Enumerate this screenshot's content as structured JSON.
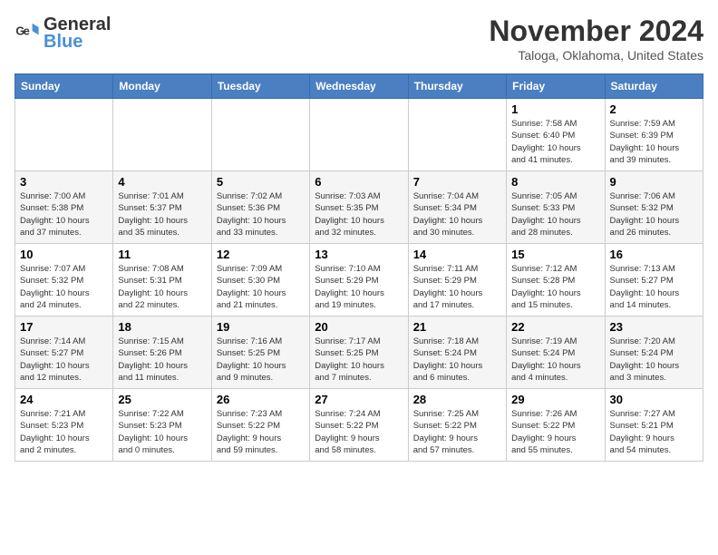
{
  "logo": {
    "line1": "General",
    "line2": "Blue"
  },
  "title": "November 2024",
  "location": "Taloga, Oklahoma, United States",
  "weekdays": [
    "Sunday",
    "Monday",
    "Tuesday",
    "Wednesday",
    "Thursday",
    "Friday",
    "Saturday"
  ],
  "weeks": [
    [
      {
        "day": "",
        "info": ""
      },
      {
        "day": "",
        "info": ""
      },
      {
        "day": "",
        "info": ""
      },
      {
        "day": "",
        "info": ""
      },
      {
        "day": "",
        "info": ""
      },
      {
        "day": "1",
        "info": "Sunrise: 7:58 AM\nSunset: 6:40 PM\nDaylight: 10 hours\nand 41 minutes."
      },
      {
        "day": "2",
        "info": "Sunrise: 7:59 AM\nSunset: 6:39 PM\nDaylight: 10 hours\nand 39 minutes."
      }
    ],
    [
      {
        "day": "3",
        "info": "Sunrise: 7:00 AM\nSunset: 5:38 PM\nDaylight: 10 hours\nand 37 minutes."
      },
      {
        "day": "4",
        "info": "Sunrise: 7:01 AM\nSunset: 5:37 PM\nDaylight: 10 hours\nand 35 minutes."
      },
      {
        "day": "5",
        "info": "Sunrise: 7:02 AM\nSunset: 5:36 PM\nDaylight: 10 hours\nand 33 minutes."
      },
      {
        "day": "6",
        "info": "Sunrise: 7:03 AM\nSunset: 5:35 PM\nDaylight: 10 hours\nand 32 minutes."
      },
      {
        "day": "7",
        "info": "Sunrise: 7:04 AM\nSunset: 5:34 PM\nDaylight: 10 hours\nand 30 minutes."
      },
      {
        "day": "8",
        "info": "Sunrise: 7:05 AM\nSunset: 5:33 PM\nDaylight: 10 hours\nand 28 minutes."
      },
      {
        "day": "9",
        "info": "Sunrise: 7:06 AM\nSunset: 5:32 PM\nDaylight: 10 hours\nand 26 minutes."
      }
    ],
    [
      {
        "day": "10",
        "info": "Sunrise: 7:07 AM\nSunset: 5:32 PM\nDaylight: 10 hours\nand 24 minutes."
      },
      {
        "day": "11",
        "info": "Sunrise: 7:08 AM\nSunset: 5:31 PM\nDaylight: 10 hours\nand 22 minutes."
      },
      {
        "day": "12",
        "info": "Sunrise: 7:09 AM\nSunset: 5:30 PM\nDaylight: 10 hours\nand 21 minutes."
      },
      {
        "day": "13",
        "info": "Sunrise: 7:10 AM\nSunset: 5:29 PM\nDaylight: 10 hours\nand 19 minutes."
      },
      {
        "day": "14",
        "info": "Sunrise: 7:11 AM\nSunset: 5:29 PM\nDaylight: 10 hours\nand 17 minutes."
      },
      {
        "day": "15",
        "info": "Sunrise: 7:12 AM\nSunset: 5:28 PM\nDaylight: 10 hours\nand 15 minutes."
      },
      {
        "day": "16",
        "info": "Sunrise: 7:13 AM\nSunset: 5:27 PM\nDaylight: 10 hours\nand 14 minutes."
      }
    ],
    [
      {
        "day": "17",
        "info": "Sunrise: 7:14 AM\nSunset: 5:27 PM\nDaylight: 10 hours\nand 12 minutes."
      },
      {
        "day": "18",
        "info": "Sunrise: 7:15 AM\nSunset: 5:26 PM\nDaylight: 10 hours\nand 11 minutes."
      },
      {
        "day": "19",
        "info": "Sunrise: 7:16 AM\nSunset: 5:25 PM\nDaylight: 10 hours\nand 9 minutes."
      },
      {
        "day": "20",
        "info": "Sunrise: 7:17 AM\nSunset: 5:25 PM\nDaylight: 10 hours\nand 7 minutes."
      },
      {
        "day": "21",
        "info": "Sunrise: 7:18 AM\nSunset: 5:24 PM\nDaylight: 10 hours\nand 6 minutes."
      },
      {
        "day": "22",
        "info": "Sunrise: 7:19 AM\nSunset: 5:24 PM\nDaylight: 10 hours\nand 4 minutes."
      },
      {
        "day": "23",
        "info": "Sunrise: 7:20 AM\nSunset: 5:24 PM\nDaylight: 10 hours\nand 3 minutes."
      }
    ],
    [
      {
        "day": "24",
        "info": "Sunrise: 7:21 AM\nSunset: 5:23 PM\nDaylight: 10 hours\nand 2 minutes."
      },
      {
        "day": "25",
        "info": "Sunrise: 7:22 AM\nSunset: 5:23 PM\nDaylight: 10 hours\nand 0 minutes."
      },
      {
        "day": "26",
        "info": "Sunrise: 7:23 AM\nSunset: 5:22 PM\nDaylight: 9 hours\nand 59 minutes."
      },
      {
        "day": "27",
        "info": "Sunrise: 7:24 AM\nSunset: 5:22 PM\nDaylight: 9 hours\nand 58 minutes."
      },
      {
        "day": "28",
        "info": "Sunrise: 7:25 AM\nSunset: 5:22 PM\nDaylight: 9 hours\nand 57 minutes."
      },
      {
        "day": "29",
        "info": "Sunrise: 7:26 AM\nSunset: 5:22 PM\nDaylight: 9 hours\nand 55 minutes."
      },
      {
        "day": "30",
        "info": "Sunrise: 7:27 AM\nSunset: 5:21 PM\nDaylight: 9 hours\nand 54 minutes."
      }
    ]
  ]
}
